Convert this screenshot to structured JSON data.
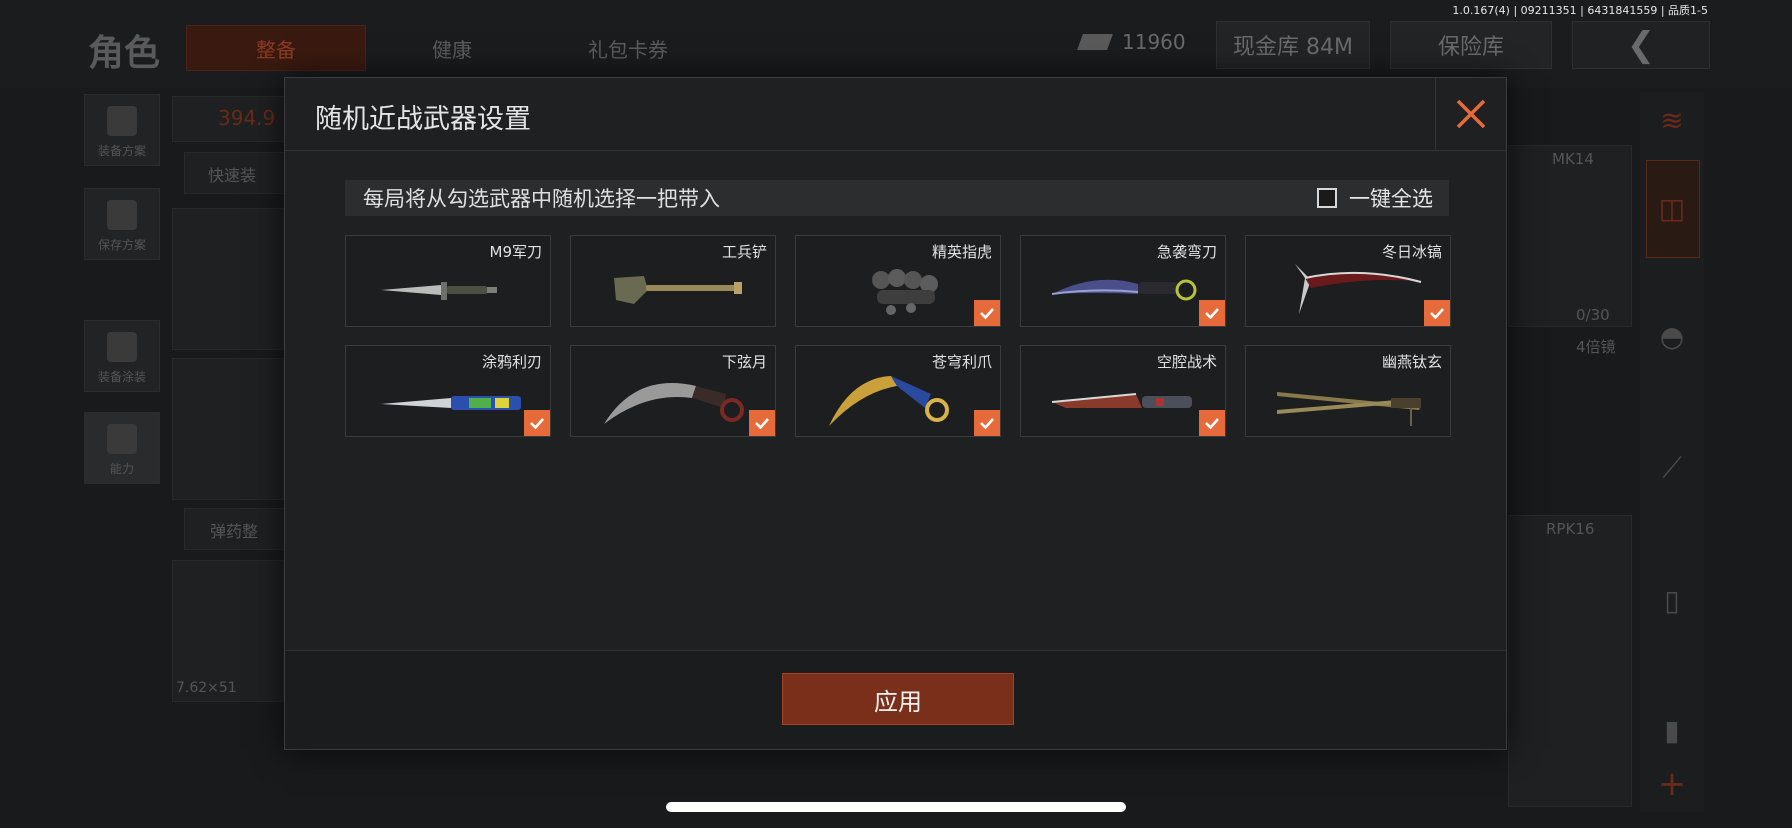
{
  "version_text": "1.0.167(4) | 09211351 | 6431841559 | 品质1-5",
  "background": {
    "title": "角色",
    "tabs": [
      "整备",
      "健康",
      "礼包卡券"
    ],
    "currency_value": "11960",
    "cash_vault_label": "现金库 84M",
    "safe_label": "保险库",
    "side_buttons": [
      "装备方案",
      "保存方案",
      "装备涂装",
      "能力"
    ],
    "panel_labels": [
      "394.9",
      "快速装",
      "弹药整",
      "7.62×51",
      "MK14",
      "0/30",
      "4倍镜",
      "RPK16"
    ]
  },
  "modal": {
    "title": "随机近战武器设置",
    "instruction": "每局将从勾选武器中随机选择一把带入",
    "select_all_label": "一键全选",
    "select_all_checked": false,
    "weapons": [
      {
        "name": "M9军刀",
        "checked": false,
        "art": "bayonet"
      },
      {
        "name": "工兵铲",
        "checked": false,
        "art": "shovel"
      },
      {
        "name": "精英指虎",
        "checked": true,
        "art": "knuckles"
      },
      {
        "name": "急袭弯刀",
        "checked": true,
        "art": "curved-knife"
      },
      {
        "name": "冬日冰镐",
        "checked": true,
        "art": "ice-pick"
      },
      {
        "name": "涂鸦利刃",
        "checked": true,
        "art": "butterfly-knife"
      },
      {
        "name": "下弦月",
        "checked": true,
        "art": "karambit"
      },
      {
        "name": "苍穹利爪",
        "checked": true,
        "art": "golden-karambit"
      },
      {
        "name": "空腔战术",
        "checked": true,
        "art": "tactical-knife"
      },
      {
        "name": "幽燕钛玄",
        "checked": false,
        "art": "twin-blades"
      }
    ],
    "apply_label": "应用"
  },
  "colors": {
    "accent": "#e66a3a",
    "apply_bg": "#7a2f1b"
  }
}
